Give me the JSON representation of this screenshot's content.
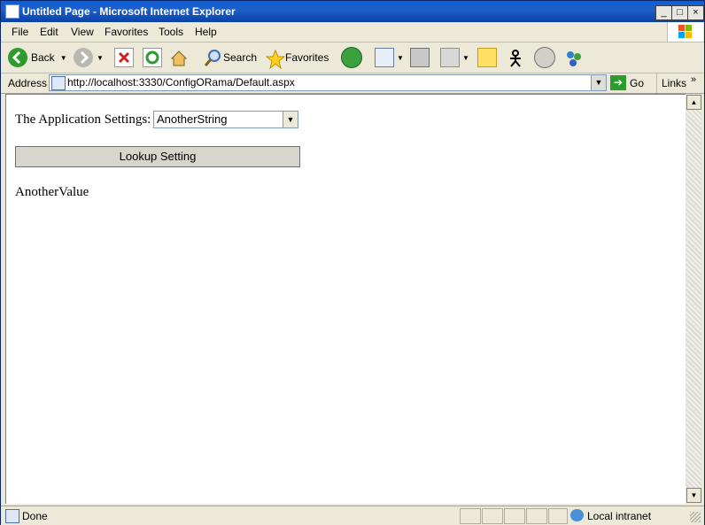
{
  "window": {
    "title": "Untitled Page - Microsoft Internet Explorer",
    "controls": {
      "minimize": "_",
      "maximize": "□",
      "close": "×"
    }
  },
  "menu": {
    "items": [
      {
        "label": "File"
      },
      {
        "label": "Edit"
      },
      {
        "label": "View"
      },
      {
        "label": "Favorites"
      },
      {
        "label": "Tools"
      },
      {
        "label": "Help"
      }
    ]
  },
  "toolbar": {
    "back_label": "Back",
    "search_label": "Search",
    "favorites_label": "Favorites",
    "icons": [
      "back-icon",
      "forward-icon",
      "stop-icon",
      "refresh-icon",
      "home-icon",
      "search-icon",
      "favorites-star-icon",
      "history-icon",
      "mail-icon",
      "print-icon",
      "edit-icon",
      "notes-icon",
      "messenger-icon",
      "discuss-icon",
      "msn-icon"
    ]
  },
  "address": {
    "label": "Address",
    "url": "http://localhost:3330/ConfigORama/Default.aspx",
    "go_label": "Go",
    "links_label": "Links"
  },
  "page": {
    "settings_label": "The Application Settings:",
    "selected_setting": "AnotherString",
    "button_label": "Lookup Setting",
    "result": "AnotherValue"
  },
  "status": {
    "text": "Done",
    "zone": "Local intranet"
  },
  "colors": {
    "titlebar": "#0a5fd8",
    "chrome": "#ece9d8",
    "accent_green": "#2e9b2e"
  }
}
